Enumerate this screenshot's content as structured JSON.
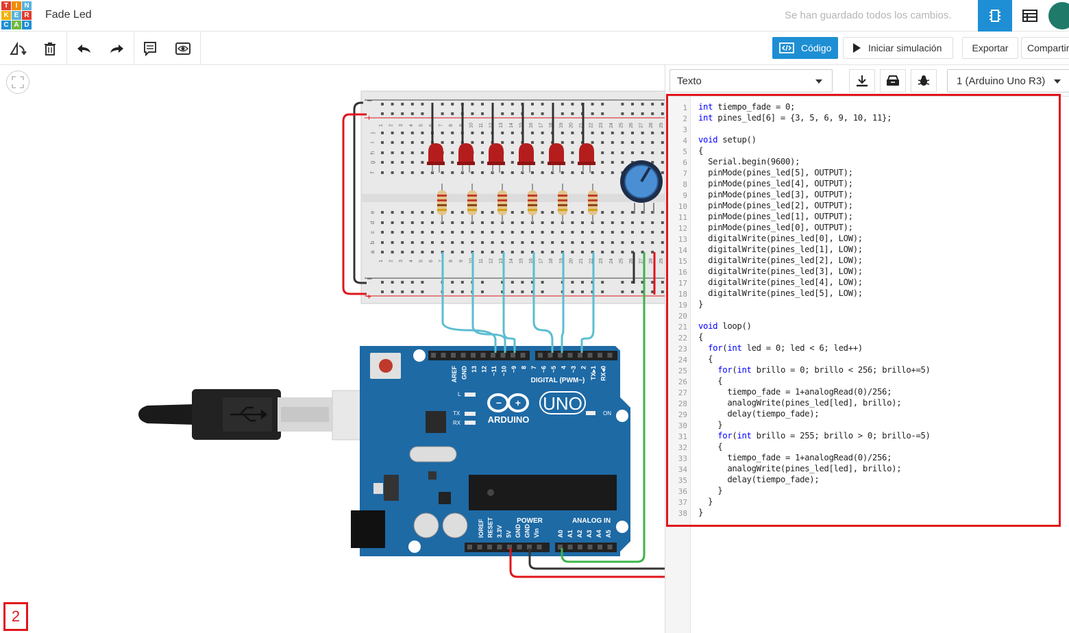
{
  "header": {
    "logo_letters": [
      "T",
      "I",
      "N",
      "K",
      "E",
      "R",
      "C",
      "A",
      "D"
    ],
    "logo_colors": [
      "#e13c2d",
      "#f28b00",
      "#58b2dc",
      "#f2b100",
      "#58b2dc",
      "#e13c2d",
      "#1e8fd4",
      "#71b843",
      "#1e8fd4"
    ],
    "project_title": "Fade Led",
    "save_status": "Se han guardado todos los cambios."
  },
  "toolbar": {
    "code_label": "Código",
    "simulate_label": "Iniciar simulación",
    "export_label": "Exportar",
    "share_label": "Compartir",
    "accent_color": "#1e8fd4"
  },
  "canvas": {
    "step_number": "2"
  },
  "code_panel": {
    "mode": "Texto",
    "device": "1 (Arduino Uno R3)",
    "code_lines": [
      "int tiempo_fade = 0;",
      "int pines_led[6] = {3, 5, 6, 9, 10, 11};",
      "",
      "void setup()",
      "{",
      "  Serial.begin(9600);",
      "  pinMode(pines_led[5], OUTPUT);",
      "  pinMode(pines_led[4], OUTPUT);",
      "  pinMode(pines_led[3], OUTPUT);",
      "  pinMode(pines_led[2], OUTPUT);",
      "  pinMode(pines_led[1], OUTPUT);",
      "  pinMode(pines_led[0], OUTPUT);",
      "  digitalWrite(pines_led[0], LOW);",
      "  digitalWrite(pines_led[1], LOW);",
      "  digitalWrite(pines_led[2], LOW);",
      "  digitalWrite(pines_led[3], LOW);",
      "  digitalWrite(pines_led[4], LOW);",
      "  digitalWrite(pines_led[5], LOW);",
      "}",
      "",
      "void loop()",
      "{",
      "  for(int led = 0; led < 6; led++)",
      "  {",
      "    for(int brillo = 0; brillo < 256; brillo+=5)",
      "    {",
      "      tiempo_fade = 1+analogRead(0)/256;",
      "      analogWrite(pines_led[led], brillo);",
      "      delay(tiempo_fade);",
      "    }",
      "    for(int brillo = 255; brillo > 0; brillo-=5)",
      "    {",
      "      tiempo_fade = 1+analogRead(0)/256;",
      "      analogWrite(pines_led[led], brillo);",
      "      delay(tiempo_fade);",
      "    }",
      "  }",
      "}"
    ]
  },
  "circuit": {
    "breadboard_row_letters": [
      "j",
      "i",
      "h",
      "g",
      "f",
      "e",
      "d",
      "c",
      "b",
      "a"
    ],
    "breadboard_columns": [
      "1",
      "2",
      "3",
      "4",
      "5",
      "6",
      "7",
      "8",
      "9",
      "10",
      "11",
      "12",
      "13",
      "14",
      "15",
      "16",
      "17",
      "18",
      "19",
      "20",
      "21",
      "22",
      "23",
      "24",
      "25",
      "26",
      "27",
      "28",
      "29",
      "30"
    ],
    "rail_plus": "+",
    "rail_minus": "–",
    "arduino_brand": "ARDUINO",
    "arduino_model": "UNO",
    "digital_label": "DIGITAL (PWM~)",
    "power_label": "POWER",
    "analog_label": "ANALOG IN",
    "on_label": "ON",
    "tx_label": "TX",
    "rx_label": "RX",
    "l_label": "L",
    "digital_pins": [
      "AREF",
      "GND",
      "13",
      "12",
      "~11",
      "~10",
      "~9",
      "8",
      "7",
      "~6",
      "~5",
      "4",
      "~3",
      "2",
      "TX▸1",
      "RX◂0"
    ],
    "power_pins": [
      "IOREF",
      "RESET",
      "3.3V",
      "5V",
      "GND",
      "GND",
      "Vin"
    ],
    "analog_pins": [
      "A0",
      "A1",
      "A2",
      "A3",
      "A4",
      "A5"
    ],
    "led_color": "#b51d1d",
    "wire_cyan": "#5bbdd0",
    "wire_green": "#3cb54a",
    "wire_red": "#e0151b",
    "board_color": "#1e6aa5"
  }
}
